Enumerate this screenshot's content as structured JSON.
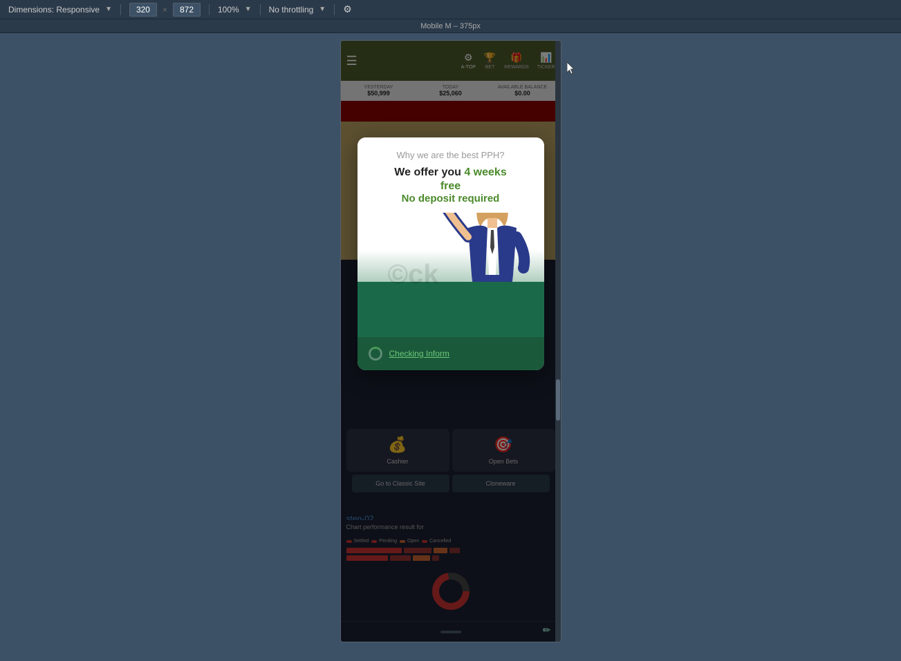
{
  "toolbar": {
    "dimensions_label": "Dimensions: Responsive",
    "width_value": "320",
    "height_value": "872",
    "zoom_label": "100%",
    "throttling_label": "No throttling",
    "separator": "×"
  },
  "ruler": {
    "label": "Mobile M – 375px"
  },
  "app": {
    "nav_items": [
      {
        "label": "A-TOP",
        "icon": "⚙"
      },
      {
        "label": "BET",
        "icon": "🏆"
      },
      {
        "label": "REWARDS",
        "icon": "🎁"
      },
      {
        "label": "TICKER",
        "icon": "📊"
      }
    ],
    "stats": [
      {
        "label": "YESTERDAY",
        "value": "$50,999"
      },
      {
        "label": "TODAY",
        "value": "$25,060"
      },
      {
        "label": "AVAILABLE BALANCE",
        "value": "$0.00"
      }
    ]
  },
  "modal": {
    "subtitle": "Why we are the best PPH?",
    "title_part1": "We offer you ",
    "title_highlight": "4 weeks",
    "title_part2": "free",
    "tagline": "No deposit required",
    "bottom_text": "Checking Inform",
    "spinner_visible": true
  },
  "bottom_grid": {
    "items": [
      {
        "label": "Cashier",
        "icon": "💰"
      },
      {
        "label": "Open Bets",
        "icon": "🎯"
      }
    ],
    "buttons": [
      {
        "label": "Go to Classic Site"
      },
      {
        "label": "Cloneware"
      }
    ]
  },
  "step": {
    "id": "step-02",
    "sublabel": "Chart performance result for"
  },
  "chart": {
    "legend": [
      {
        "label": "Settled",
        "color": "#cc3333"
      },
      {
        "label": "Pending",
        "color": "#cc3333"
      },
      {
        "label": "Open",
        "color": "#cc6633"
      },
      {
        "label": "Cancelled",
        "color": "#cc3333"
      }
    ],
    "bar_rows": [
      {
        "segments": [
          80,
          40,
          20,
          15
        ]
      },
      {
        "segments": [
          60,
          30,
          25,
          10
        ]
      }
    ]
  },
  "bottom_bar": {
    "handle_visible": true
  },
  "watermark": {
    "text": "©ck"
  },
  "cursor": {
    "visible": true
  }
}
